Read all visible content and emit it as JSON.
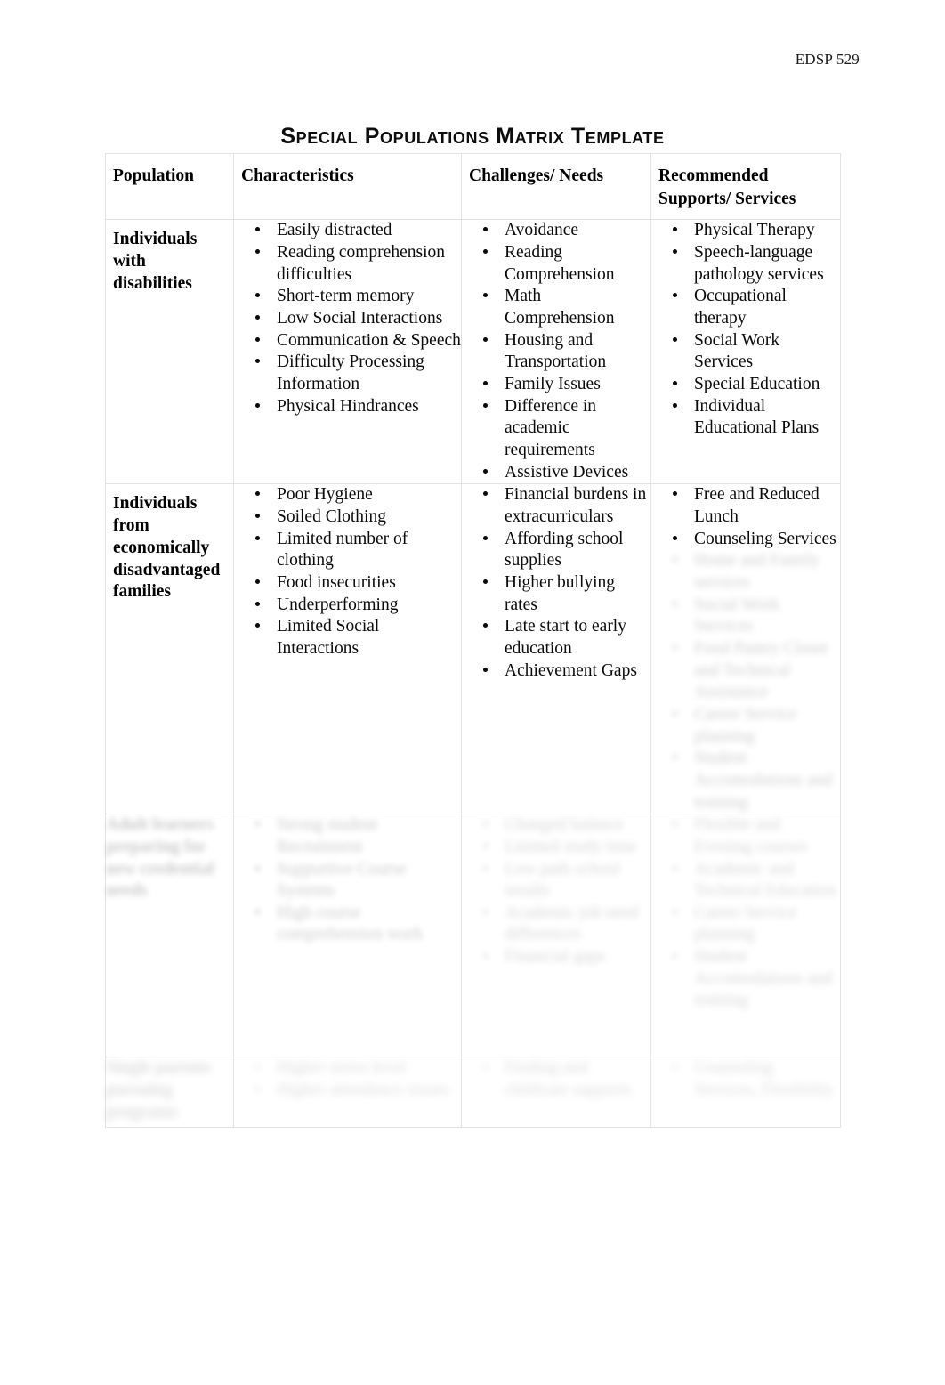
{
  "document": {
    "running_header": "EDSP 529",
    "title": "Special Populations Matrix Template"
  },
  "table": {
    "headers": [
      "Population",
      "Characteristics",
      "Challenges/ Needs",
      "Recommended Supports/ Services"
    ],
    "rows": [
      {
        "population": "Individuals with disabilities",
        "characteristics": [
          "Easily distracted",
          "Reading comprehension difficulties",
          "Short-term memory",
          "Low Social Interactions",
          "Communication & Speech",
          "Difficulty Processing Information",
          "Physical Hindrances"
        ],
        "challenges": [
          "Avoidance",
          "Reading Comprehension",
          "Math Comprehension",
          "Housing and Transportation",
          "Family Issues",
          "Difference in academic requirements",
          "Assistive Devices"
        ],
        "supports": [
          "Physical Therapy",
          "Speech-language pathology services",
          "Occupational therapy",
          "Social Work Services",
          "Special Education",
          "Individual Educational Plans"
        ]
      },
      {
        "population": "Individuals from economically disadvantaged families",
        "characteristics": [
          "Poor Hygiene",
          "Soiled Clothing",
          "Limited number of clothing",
          "Food insecurities",
          "Underperforming",
          "Limited Social Interactions"
        ],
        "challenges": [
          "Financial burdens in extracurriculars",
          "Affording school supplies",
          "Higher bullying rates",
          "Late start to early education",
          "Achievement Gaps"
        ],
        "supports": [
          "Free and Reduced Lunch",
          "Counseling Services",
          "Home and Family services",
          "Social Work Services",
          "Food Pantry Closet and Technical Assistance",
          "Career Service planning",
          "Student Accomodations and training"
        ]
      },
      {
        "population": "Adult learners preparing for new credential needs",
        "characteristics": [
          "Strong student Recruitment",
          "Supportive Course Systems",
          "High course comprehension work"
        ],
        "challenges": [
          "Changed balance",
          "Limited study time",
          "Low path school results",
          "Academic job need differences",
          "Financial gaps"
        ],
        "supports": [
          "Flexible and Evening courses",
          "Academic and Technical Education",
          "Career Service planning",
          "Student Accomodations and training"
        ]
      },
      {
        "population": "Single parents pursuing programs",
        "characteristics": [
          "Higher stress level",
          "Higher attendance issues"
        ],
        "challenges": [
          "Finding and childcare supports"
        ],
        "supports": [
          "Counseling Services, Flexibility"
        ]
      }
    ]
  }
}
